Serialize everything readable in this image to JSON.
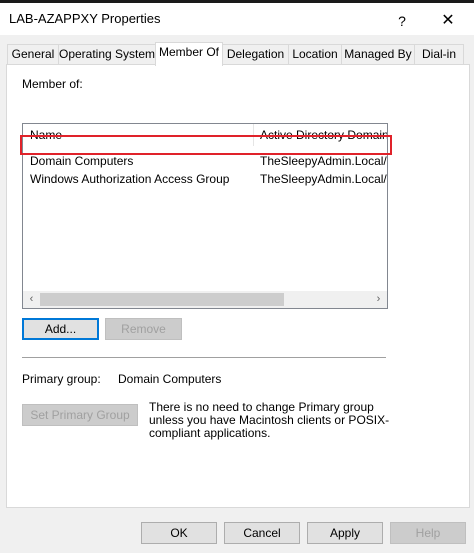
{
  "window": {
    "title": "LAB-AZAPPXY Properties",
    "help_glyph": "?",
    "close_glyph": "✕"
  },
  "tabs": [
    {
      "label": "General",
      "active": false
    },
    {
      "label": "Operating System",
      "active": false
    },
    {
      "label": "Member Of",
      "active": true
    },
    {
      "label": "Delegation",
      "active": false
    },
    {
      "label": "Location",
      "active": false
    },
    {
      "label": "Managed By",
      "active": false
    },
    {
      "label": "Dial-in",
      "active": false
    }
  ],
  "member_of": {
    "label": "Member of:",
    "columns": [
      "Name",
      "Active Directory Domain S"
    ],
    "rows": [
      {
        "name": "Domain Computers",
        "ad_path": "TheSleepyAdmin.Local/Us"
      },
      {
        "name": "Windows Authorization Access Group",
        "ad_path": "TheSleepyAdmin.Local/Bu"
      }
    ],
    "highlighted_row": 1,
    "scroll_left": "‹",
    "scroll_right": "›"
  },
  "buttons": {
    "add": "Add...",
    "remove": "Remove",
    "set_primary": "Set Primary Group",
    "ok": "OK",
    "cancel": "Cancel",
    "apply": "Apply",
    "help": "Help"
  },
  "primary_group": {
    "label": "Primary group:",
    "value": "Domain Computers",
    "note": "There is no need to change Primary group unless you have Macintosh clients or POSIX-compliant applications."
  },
  "colors": {
    "highlight_border": "#e0222a",
    "default_button_border": "#0078d7"
  }
}
